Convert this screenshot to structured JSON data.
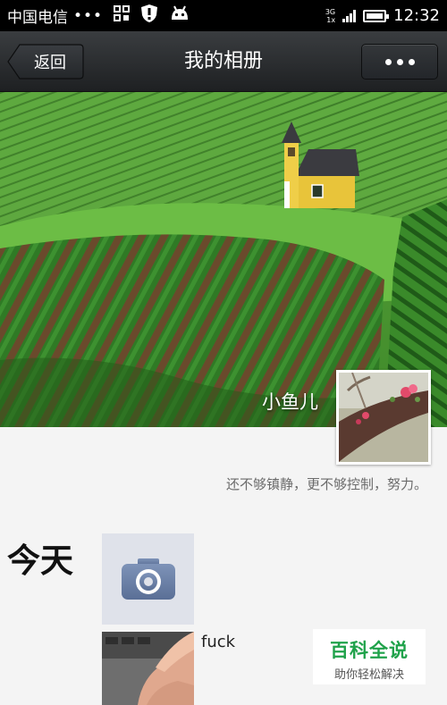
{
  "status_bar": {
    "carrier": "中国电信",
    "dots": "•••",
    "network_top": "3G",
    "network_bottom": "1x",
    "time": "12:32",
    "icons": [
      "grid-icon",
      "shield-icon",
      "android-icon",
      "signal-icon",
      "battery-icon"
    ]
  },
  "nav": {
    "back_label": "返回",
    "title": "我的相册",
    "more_icon": "more-dots-icon"
  },
  "profile": {
    "name": "小鱼儿",
    "signature": "还不够镇静，更不够控制，努力。"
  },
  "timeline": {
    "day_label": "今天",
    "camera_icon": "camera-icon",
    "post_text": "fuck"
  },
  "watermark": {
    "title": "百科全说",
    "subtitle": "助你轻松解决"
  }
}
